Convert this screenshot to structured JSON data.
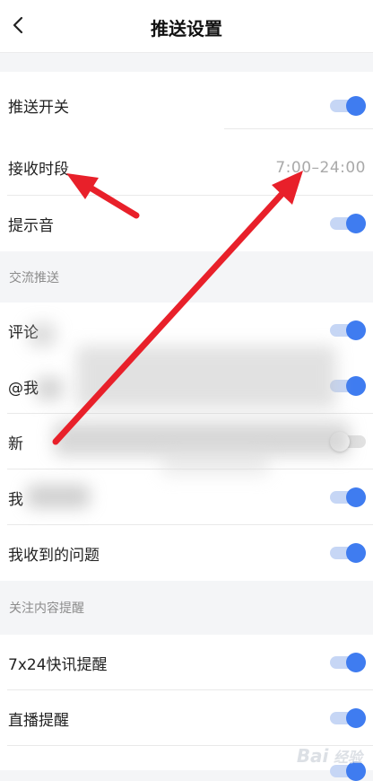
{
  "header": {
    "title": "推送设置"
  },
  "rows": {
    "push_switch": {
      "label": "推送开关",
      "on": true
    },
    "receive_period": {
      "label": "接收时段",
      "value": "7:00–24:00"
    },
    "sound": {
      "label": "提示音",
      "on": true
    },
    "comment": {
      "label": "评论",
      "on": true
    },
    "mention": {
      "label": "@我",
      "on": true
    },
    "new_item": {
      "label": "新",
      "on": false
    },
    "my_item": {
      "label": "我",
      "on": true
    },
    "my_questions": {
      "label": "我收到的问题",
      "on": true
    },
    "flash_news": {
      "label": "7x24快讯提醒",
      "on": true
    },
    "live": {
      "label": "直播提醒",
      "on": true
    }
  },
  "sections": {
    "exchange": "交流推送",
    "follow": "关注内容提醒"
  },
  "watermark": "Bai 经验",
  "colors": {
    "accent": "#3f7cf0",
    "annotation_arrow": "#e8202a"
  }
}
